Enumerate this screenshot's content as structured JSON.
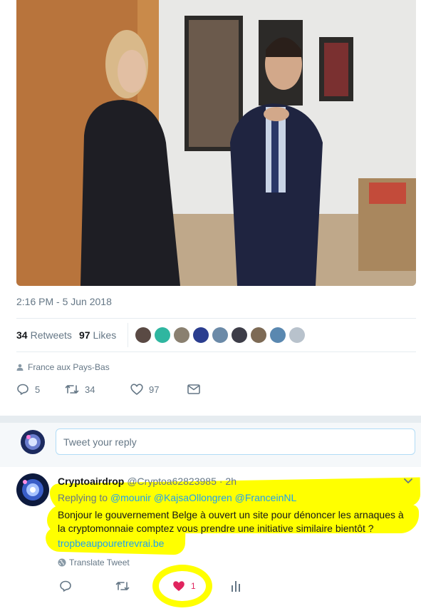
{
  "tweet": {
    "timestamp": "2:16 PM - 5 Jun 2018",
    "retweets": {
      "count": "34",
      "label": "Retweets"
    },
    "likes": {
      "count": "97",
      "label": "Likes"
    },
    "location": "France aux Pays-Bas",
    "actions": {
      "reply_count": "5",
      "retweet_count": "34",
      "like_count": "97"
    }
  },
  "liker_avatars": [
    "#5a4a44",
    "#2fb6a0",
    "#8a8070",
    "#2a3d8f",
    "#6b8aa8",
    "#3d3d48",
    "#7d6a55",
    "#5a88b0",
    "#b8c2cc"
  ],
  "reply_box": {
    "placeholder": "Tweet your reply"
  },
  "reply": {
    "name": "Cryptoairdrop",
    "handle": "@Cryptoa62823985",
    "time": "· 2h",
    "replying_to_label": "Replying to",
    "mentions": [
      "@mounir",
      "@KajsaOllongren",
      "@FranceinNL"
    ],
    "text": "Bonjour le gouvernement Belge à ouvert un site pour dénoncer les arnaques à la cryptomonnaie comptez vous prendre une initiative similaire bientôt ?",
    "link": "tropbeaupouretrevrai.be",
    "translate_label": "Translate Tweet",
    "like_count": "1"
  },
  "colors": {
    "accent": "#1da1f2",
    "like": "#e0245e",
    "muted": "#657786",
    "highlight": "#ffff00"
  }
}
